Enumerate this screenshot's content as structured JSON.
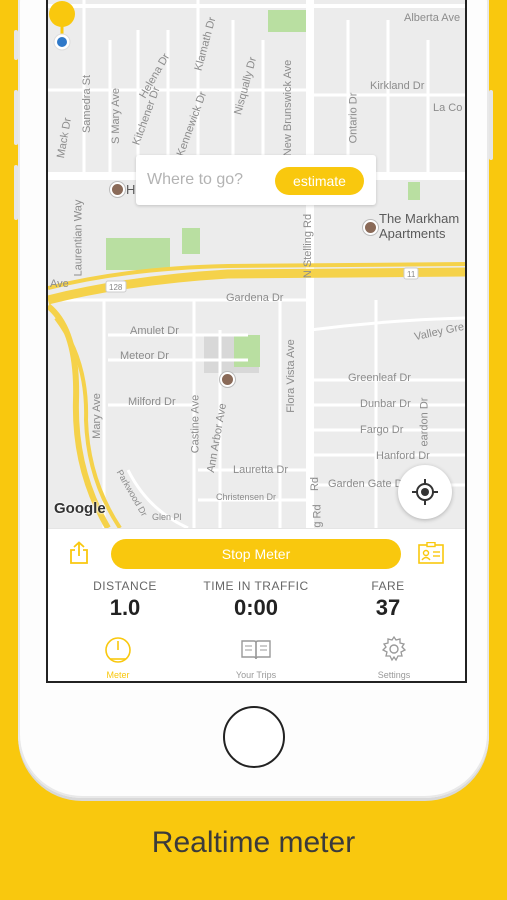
{
  "map": {
    "search_placeholder": "Where to go?",
    "estimate_label": "estimate",
    "attribution": "Google",
    "streets": [
      "Alberta Ave",
      "Helena Dr",
      "Klamath Dr",
      "Nisqually Dr",
      "New Brunswick Ave",
      "Kirkland Dr",
      "La Co",
      "Samedra St",
      "Kitchener Dr",
      "Kennewick Dr",
      "Ontario Dr",
      "Laurentian Way",
      "Mack Dr",
      "S Mary Ave",
      "Ave",
      "N Stelling Rd",
      "Gardena Dr",
      "Amulet Dr",
      "Meteor Dr",
      "Valley Gre",
      "Greenleaf Dr",
      "Milford Dr",
      "Mary Ave",
      "Castine Ave",
      "Ann Arbor Ave",
      "Flora Vista Ave",
      "Dunbar Dr",
      "Fargo Dr",
      "Hanford Dr",
      "Lauretta Dr",
      "Garden Gate Dr",
      "Christensen Dr",
      "Glen Pl",
      "Parkwood Dr",
      "eardon Dr",
      "g Rd",
      "Rd",
      "128",
      "11"
    ],
    "pois": {
      "place_1": "H",
      "place_2": "The Markham Apartments"
    }
  },
  "meter": {
    "stop_label": "Stop Meter",
    "stats": [
      {
        "label": "DISTANCE",
        "value": "1.0"
      },
      {
        "label": "TIME IN TRAFFIC",
        "value": "0:00"
      },
      {
        "label": "FARE",
        "value": "37"
      }
    ]
  },
  "tabs": [
    {
      "label": "Meter",
      "icon": "speedometer-icon",
      "active": true
    },
    {
      "label": "Your Trips",
      "icon": "book-icon",
      "active": false
    },
    {
      "label": "Settings",
      "icon": "gear-icon",
      "active": false
    }
  ],
  "caption": "Realtime meter",
  "colors": {
    "accent": "#F9C80E",
    "background": "#F9C80E",
    "map": "#ECECEC",
    "highway": "#F5D24A"
  }
}
